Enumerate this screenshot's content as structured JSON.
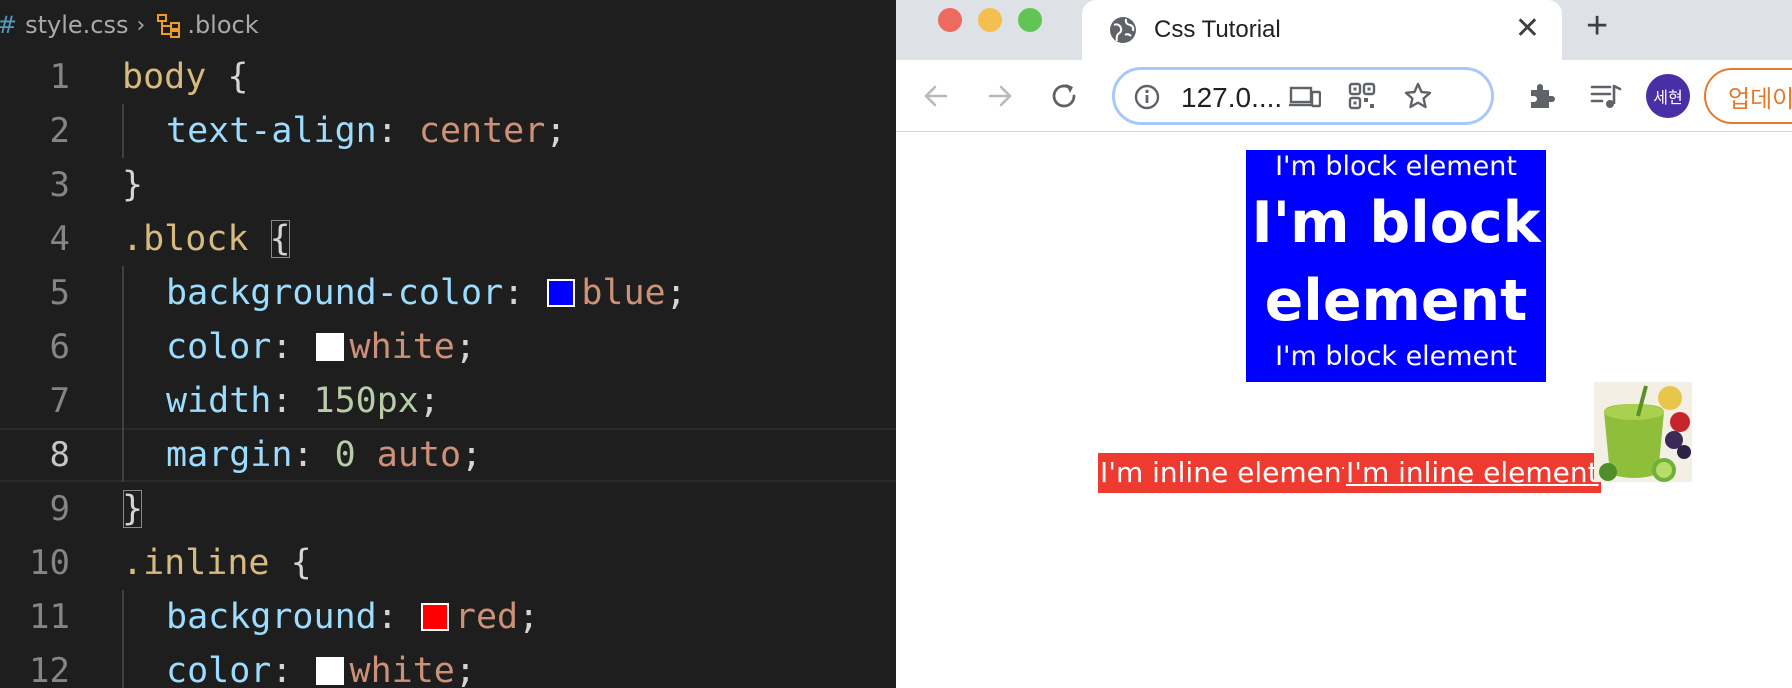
{
  "editor": {
    "breadcrumb": {
      "file": "style.css",
      "symbol": ".block"
    },
    "lines": [
      {
        "num": "1",
        "tokens": [
          [
            "sel",
            "body"
          ],
          [
            "punc",
            " {"
          ]
        ]
      },
      {
        "num": "2",
        "indent": true,
        "tokens": [
          [
            "prop",
            "text-align"
          ],
          [
            "punc",
            ": "
          ],
          [
            "val",
            "center"
          ],
          [
            "punc",
            ";"
          ]
        ]
      },
      {
        "num": "3",
        "tokens": [
          [
            "punc",
            "}"
          ]
        ]
      },
      {
        "num": "4",
        "tokens": [
          [
            "sel",
            ".block"
          ],
          [
            "punc",
            " "
          ],
          [
            "bracket",
            "{"
          ]
        ]
      },
      {
        "num": "5",
        "indent": true,
        "tokens": [
          [
            "prop",
            "background-color"
          ],
          [
            "punc",
            ": "
          ],
          [
            "swatch",
            "#0000ff"
          ],
          [
            "val",
            "blue"
          ],
          [
            "punc",
            ";"
          ]
        ]
      },
      {
        "num": "6",
        "indent": true,
        "tokens": [
          [
            "prop",
            "color"
          ],
          [
            "punc",
            ": "
          ],
          [
            "swatch",
            "#ffffff"
          ],
          [
            "val",
            "white"
          ],
          [
            "punc",
            ";"
          ]
        ]
      },
      {
        "num": "7",
        "indent": true,
        "tokens": [
          [
            "prop",
            "width"
          ],
          [
            "punc",
            ": "
          ],
          [
            "num",
            "150px"
          ],
          [
            "punc",
            ";"
          ]
        ]
      },
      {
        "num": "8",
        "indent": true,
        "active": true,
        "tokens": [
          [
            "prop",
            "margin"
          ],
          [
            "punc",
            ": "
          ],
          [
            "num",
            "0"
          ],
          [
            "punc",
            " "
          ],
          [
            "val",
            "auto"
          ],
          [
            "punc",
            ";"
          ]
        ]
      },
      {
        "num": "9",
        "tokens": [
          [
            "bracket",
            "}"
          ]
        ]
      },
      {
        "num": "10",
        "tokens": [
          [
            "sel",
            ".inline"
          ],
          [
            "punc",
            " {"
          ]
        ]
      },
      {
        "num": "11",
        "indent": true,
        "tokens": [
          [
            "prop",
            "background"
          ],
          [
            "punc",
            ": "
          ],
          [
            "swatch",
            "#ff0000"
          ],
          [
            "val",
            "red"
          ],
          [
            "punc",
            ";"
          ]
        ]
      },
      {
        "num": "12",
        "indent": true,
        "tokens": [
          [
            "prop",
            "color"
          ],
          [
            "punc",
            ": "
          ],
          [
            "swatch",
            "#ffffff"
          ],
          [
            "val",
            "white"
          ],
          [
            "punc",
            ";"
          ]
        ]
      }
    ]
  },
  "browser": {
    "tab_title": "Css Tutorial",
    "close_glyph": "✕",
    "newtab_glyph": "+",
    "url": "127.0....",
    "profile_initials": "세현",
    "update_label": "업데이",
    "page": {
      "block_line1": "I'm block element",
      "block_line2": "I'm block element",
      "block_line3": "I'm block element",
      "inline1": "I'm inline element",
      "inline2": "I'm inline element"
    }
  },
  "colors": {
    "block_bg": "#0000ff",
    "inline_bg": "#ee3a2f",
    "editor_bg": "#1e1e1e"
  }
}
